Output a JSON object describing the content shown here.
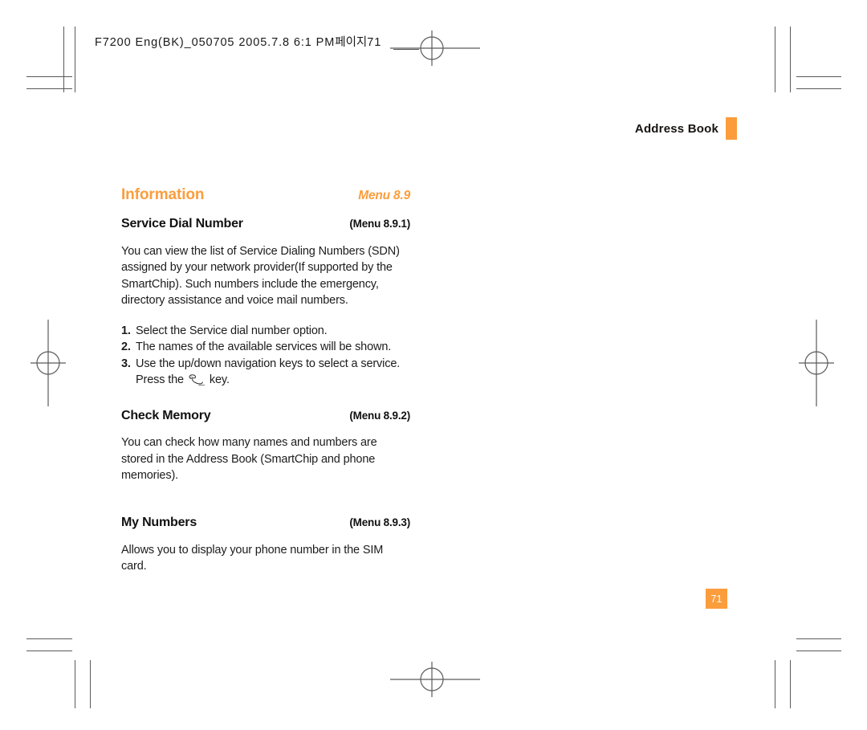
{
  "prepress": {
    "slug_text": "F7200 Eng(BK)_050705  2005.7.8  6:1 PM",
    "slug_korean": "페이지",
    "slug_page": "71"
  },
  "running_head": {
    "label": "Address Book",
    "accent_color": "#fb9d3d"
  },
  "section": {
    "title": "Information",
    "menu": "Menu 8.9"
  },
  "subsections": [
    {
      "title": "Service Dial Number",
      "menu": "(Menu 8.9.1)",
      "body": "You can view the list of Service Dialing Numbers (SDN) assigned by your network provider(If supported by the SmartChip). Such numbers include the emergency, directory assistance and voice mail numbers.",
      "steps": [
        {
          "num": "1.",
          "text": "Select the Service dial number option."
        },
        {
          "num": "2.",
          "text": "The names of the available services will be shown."
        },
        {
          "num": "3.",
          "text": "Use the up/down navigation keys to select a service."
        }
      ],
      "step3_continuation_before": "Press the",
      "step3_continuation_icon": "send-key-icon",
      "step3_continuation_after": "key."
    },
    {
      "title": "Check Memory",
      "menu": "(Menu 8.9.2)",
      "body": "You can check how many names and numbers are stored in the Address Book (SmartChip and phone memories)."
    },
    {
      "title": "My Numbers",
      "menu": "(Menu 8.9.3)",
      "body": "Allows you to display your phone number in the SIM card."
    }
  ],
  "page_number": "71",
  "colors": {
    "accent_orange": "#fb9d3d",
    "text_black": "#1c1c1c",
    "mark_gray": "#5a5a5a"
  }
}
